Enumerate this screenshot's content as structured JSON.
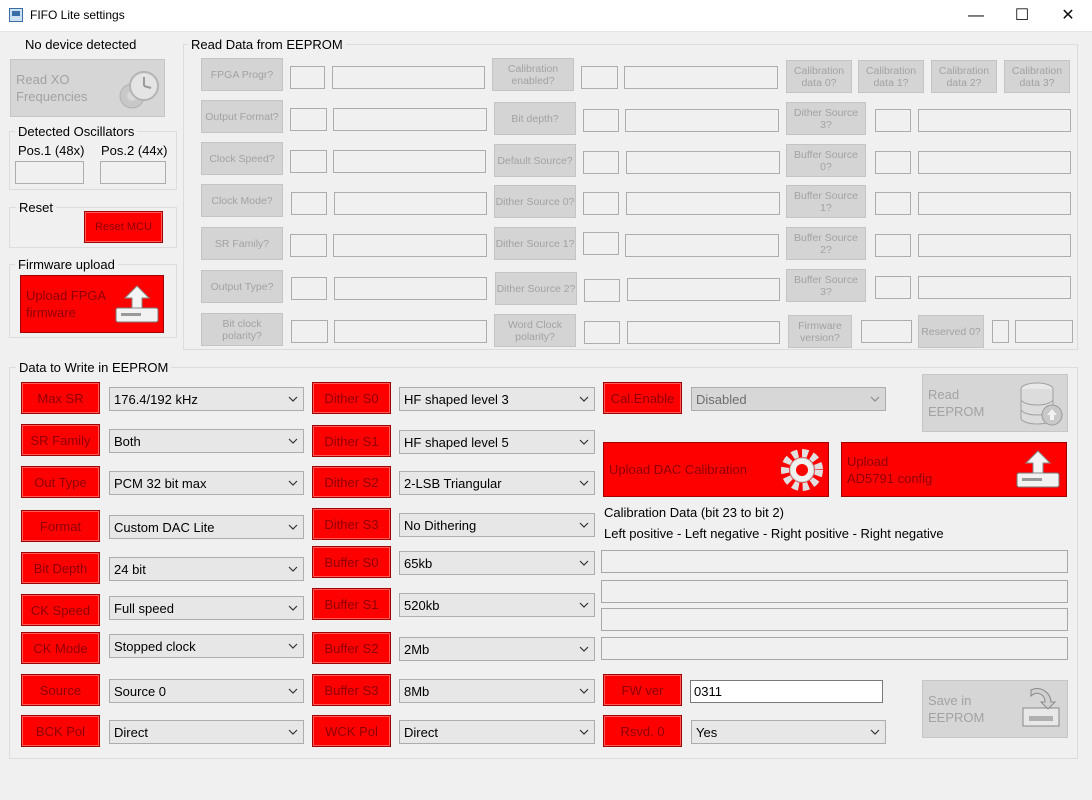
{
  "window": {
    "title": "FIFO Lite settings",
    "minimize": "—",
    "maximize": "☐",
    "close": "✕"
  },
  "status": {
    "device": "No device detected"
  },
  "left": {
    "read_xo_label": "Read XO\nFrequencies",
    "detected_group": "Detected Oscillators",
    "pos1": "Pos.1 (48x)",
    "pos2": "Pos.2 (44x)",
    "reset_group": "Reset",
    "reset_button": "Reset MCU",
    "firmware_group": "Firmware upload",
    "upload_fpga": "Upload FPGA\nfirmware"
  },
  "read": {
    "group": "Read Data from EEPROM",
    "buttons": [
      "FPGA Progr?",
      "Output Format?",
      "Clock Speed?",
      "Clock Mode?",
      "SR Family?",
      "Output Type?",
      "Bit clock polarity?",
      "Calibration enabled?",
      "Bit depth?",
      "Default Source?",
      "Dither Source 0?",
      "Dither Source 1?",
      "Dither Source 2?",
      "Word Clock polarity?",
      "Calibration data 0?",
      "Calibration data 1?",
      "Calibration data 2?",
      "Calibration data 3?",
      "Dither Source 3?",
      "Buffer Source 0?",
      "Buffer Source 1?",
      "Buffer Source 2?",
      "Buffer Source 3?",
      "Firmware version?",
      "Reserved 0?"
    ]
  },
  "write": {
    "group": "Data to Write in EEPROM",
    "col1": [
      {
        "label": "Max SR",
        "value": "176.4/192 kHz"
      },
      {
        "label": "SR Family",
        "value": "Both"
      },
      {
        "label": "Out Type",
        "value": "PCM 32 bit max"
      },
      {
        "label": "Format",
        "value": "Custom DAC Lite"
      },
      {
        "label": "Bit Depth",
        "value": "24 bit"
      },
      {
        "label": "CK Speed",
        "value": "Full speed"
      },
      {
        "label": "CK Mode",
        "value": "Stopped clock"
      },
      {
        "label": "Source",
        "value": "Source 0"
      },
      {
        "label": "BCK Pol",
        "value": "Direct"
      }
    ],
    "col2": [
      {
        "label": "Dither S0",
        "value": "HF shaped level 3"
      },
      {
        "label": "Dither S1",
        "value": "HF shaped level 5"
      },
      {
        "label": "Dither S2",
        "value": "2-LSB Triangular"
      },
      {
        "label": "Dither S3",
        "value": "No Dithering"
      },
      {
        "label": "Buffer S0",
        "value": "65kb"
      },
      {
        "label": "Buffer S1",
        "value": "520kb"
      },
      {
        "label": "Buffer S2",
        "value": "2Mb"
      },
      {
        "label": "Buffer S3",
        "value": "8Mb"
      },
      {
        "label": "WCK Pol",
        "value": "Direct"
      }
    ],
    "cal_enable": {
      "label": "Cal.Enable",
      "value": "Disabled"
    },
    "read_eeprom": "Read\nEEPROM",
    "upload_dac": "Upload DAC Calibration",
    "upload_ad": "Upload\nAD5791 config",
    "cal_title": "Calibration Data (bit 23 to bit 2)",
    "cal_desc": "Left positive - Left negative - Right positive - Right negative",
    "fw_ver": {
      "label": "FW ver",
      "value": "0311"
    },
    "rsvd": {
      "label": "Rsvd. 0",
      "value": "Yes"
    },
    "save_eeprom": "Save in\nEEPROM"
  }
}
